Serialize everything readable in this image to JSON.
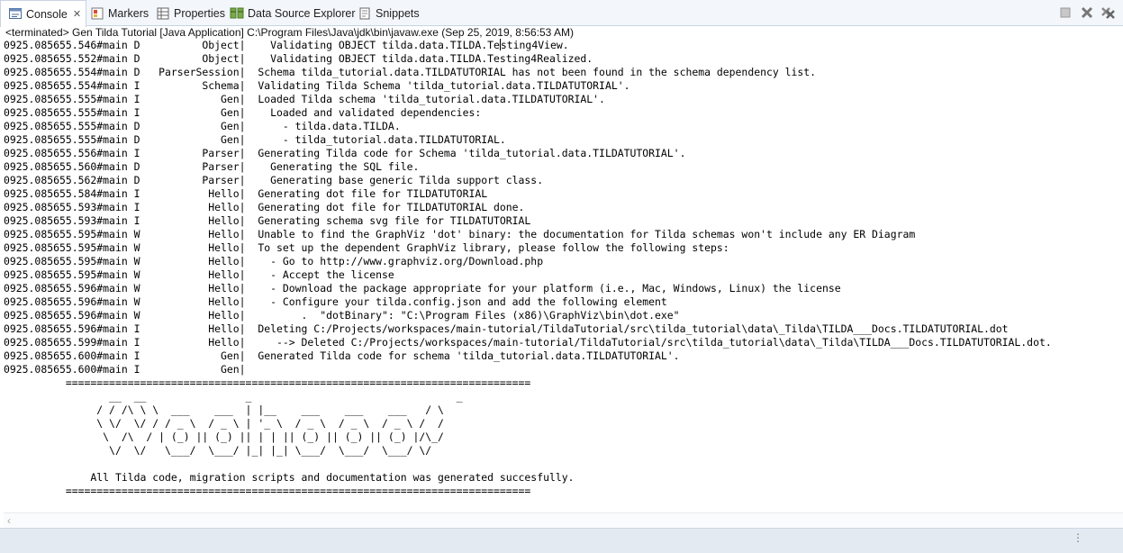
{
  "tabs": [
    {
      "label": "Console",
      "icon": "console-icon",
      "active": true
    },
    {
      "label": "Markers",
      "icon": "markers-icon"
    },
    {
      "label": "Properties",
      "icon": "properties-icon"
    },
    {
      "label": "Data Source Explorer",
      "icon": "data-source-explorer-icon"
    },
    {
      "label": "Snippets",
      "icon": "snippets-icon"
    }
  ],
  "view_buttons": [
    "terminate-icon",
    "remove-launch-icon",
    "remove-all-terminated-icon"
  ],
  "status_line": "<terminated> Gen Tilda Tutorial [Java Application] C:\\Program Files\\Java\\jdk\\bin\\javaw.exe (Sep 25, 2019, 8:56:53 AM)",
  "console": {
    "log_lines": [
      {
        "ts": "0925.085655.546#main",
        "lvl": "D",
        "src": "Object",
        "msg": "  Validating OBJECT tilda.data.TILDA.Te",
        "msg2": "sting4View."
      },
      {
        "ts": "0925.085655.552#main",
        "lvl": "D",
        "src": "Object",
        "msg": "  Validating OBJECT tilda.data.TILDA.Testing4Realized."
      },
      {
        "ts": "0925.085655.554#main",
        "lvl": "D",
        "src": "ParserSession",
        "msg": "Schema tilda_tutorial.data.TILDATUTORIAL has not been found in the schema dependency list."
      },
      {
        "ts": "0925.085655.554#main",
        "lvl": "I",
        "src": "Schema",
        "msg": "Validating Tilda Schema 'tilda_tutorial.data.TILDATUTORIAL'."
      },
      {
        "ts": "0925.085655.555#main",
        "lvl": "I",
        "src": "Gen",
        "msg": "Loaded Tilda schema 'tilda_tutorial.data.TILDATUTORIAL'."
      },
      {
        "ts": "0925.085655.555#main",
        "lvl": "I",
        "src": "Gen",
        "msg": "  Loaded and validated dependencies:"
      },
      {
        "ts": "0925.085655.555#main",
        "lvl": "D",
        "src": "Gen",
        "msg": "    - tilda.data.TILDA."
      },
      {
        "ts": "0925.085655.555#main",
        "lvl": "D",
        "src": "Gen",
        "msg": "    - tilda_tutorial.data.TILDATUTORIAL."
      },
      {
        "ts": "0925.085655.556#main",
        "lvl": "I",
        "src": "Parser",
        "msg": "Generating Tilda code for Schema 'tilda_tutorial.data.TILDATUTORIAL'."
      },
      {
        "ts": "0925.085655.560#main",
        "lvl": "D",
        "src": "Parser",
        "msg": "  Generating the SQL file."
      },
      {
        "ts": "0925.085655.562#main",
        "lvl": "D",
        "src": "Parser",
        "msg": "  Generating base generic Tilda support class."
      },
      {
        "ts": "0925.085655.584#main",
        "lvl": "I",
        "src": "Hello",
        "msg": "Generating dot file for TILDATUTORIAL"
      },
      {
        "ts": "0925.085655.593#main",
        "lvl": "I",
        "src": "Hello",
        "msg": "Generating dot file for TILDATUTORIAL done."
      },
      {
        "ts": "0925.085655.593#main",
        "lvl": "I",
        "src": "Hello",
        "msg": "Generating schema svg file for TILDATUTORIAL"
      },
      {
        "ts": "0925.085655.595#main",
        "lvl": "W",
        "src": "Hello",
        "msg": "Unable to find the GraphViz 'dot' binary: the documentation for Tilda schemas won't include any ER Diagram"
      },
      {
        "ts": "0925.085655.595#main",
        "lvl": "W",
        "src": "Hello",
        "msg": "To set up the dependent GraphViz library, please follow the following steps:"
      },
      {
        "ts": "0925.085655.595#main",
        "lvl": "W",
        "src": "Hello",
        "msg": "  - Go to http://www.graphviz.org/Download.php"
      },
      {
        "ts": "0925.085655.595#main",
        "lvl": "W",
        "src": "Hello",
        "msg": "  - Accept the license"
      },
      {
        "ts": "0925.085655.596#main",
        "lvl": "W",
        "src": "Hello",
        "msg": "  - Download the package appropriate for your platform (i.e., Mac, Windows, Linux) the license"
      },
      {
        "ts": "0925.085655.596#main",
        "lvl": "W",
        "src": "Hello",
        "msg": "  - Configure your tilda.config.json and add the following element"
      },
      {
        "ts": "0925.085655.596#main",
        "lvl": "W",
        "src": "Hello",
        "msg": "       .  \"dotBinary\": \"C:\\Program Files (x86)\\GraphViz\\bin\\dot.exe\""
      },
      {
        "ts": "0925.085655.596#main",
        "lvl": "I",
        "src": "Hello",
        "msg": "Deleting C:/Projects/workspaces/main-tutorial/TildaTutorial/src\\tilda_tutorial\\data\\_Tilda\\TILDA___Docs.TILDATUTORIAL.dot"
      },
      {
        "ts": "0925.085655.599#main",
        "lvl": "I",
        "src": "Hello",
        "msg": "   --> Deleted C:/Projects/workspaces/main-tutorial/TildaTutorial/src\\tilda_tutorial\\data\\_Tilda\\TILDA___Docs.TILDATUTORIAL.dot."
      },
      {
        "ts": "0925.085655.600#main",
        "lvl": "I",
        "src": "Gen",
        "msg": "Generated Tilda code for schema 'tilda_tutorial.data.TILDATUTORIAL'."
      },
      {
        "ts": "0925.085655.600#main",
        "lvl": "I",
        "src": "Gen",
        "msg": ""
      }
    ],
    "banner": [
      "          ===========================================================================",
      "                 __  __                _                                 _",
      "               / / /\\ \\ \\  ___    ___  | |__    ___    ___    ___   / \\",
      "               \\ \\/  \\/ / / _ \\  / _ \\ | '_ \\  / _ \\  / _ \\  / _ \\ /  /",
      "                \\  /\\  / | (_) || (_) || | | || (_) || (_) || (_) |/\\_/",
      "                 \\/  \\/   \\___/  \\___/ |_| |_| \\___/  \\___/  \\___/ \\/",
      "",
      "              All Tilda code, migration scripts and documentation was generated succesfully.",
      "          ==========================================================================="
    ]
  }
}
